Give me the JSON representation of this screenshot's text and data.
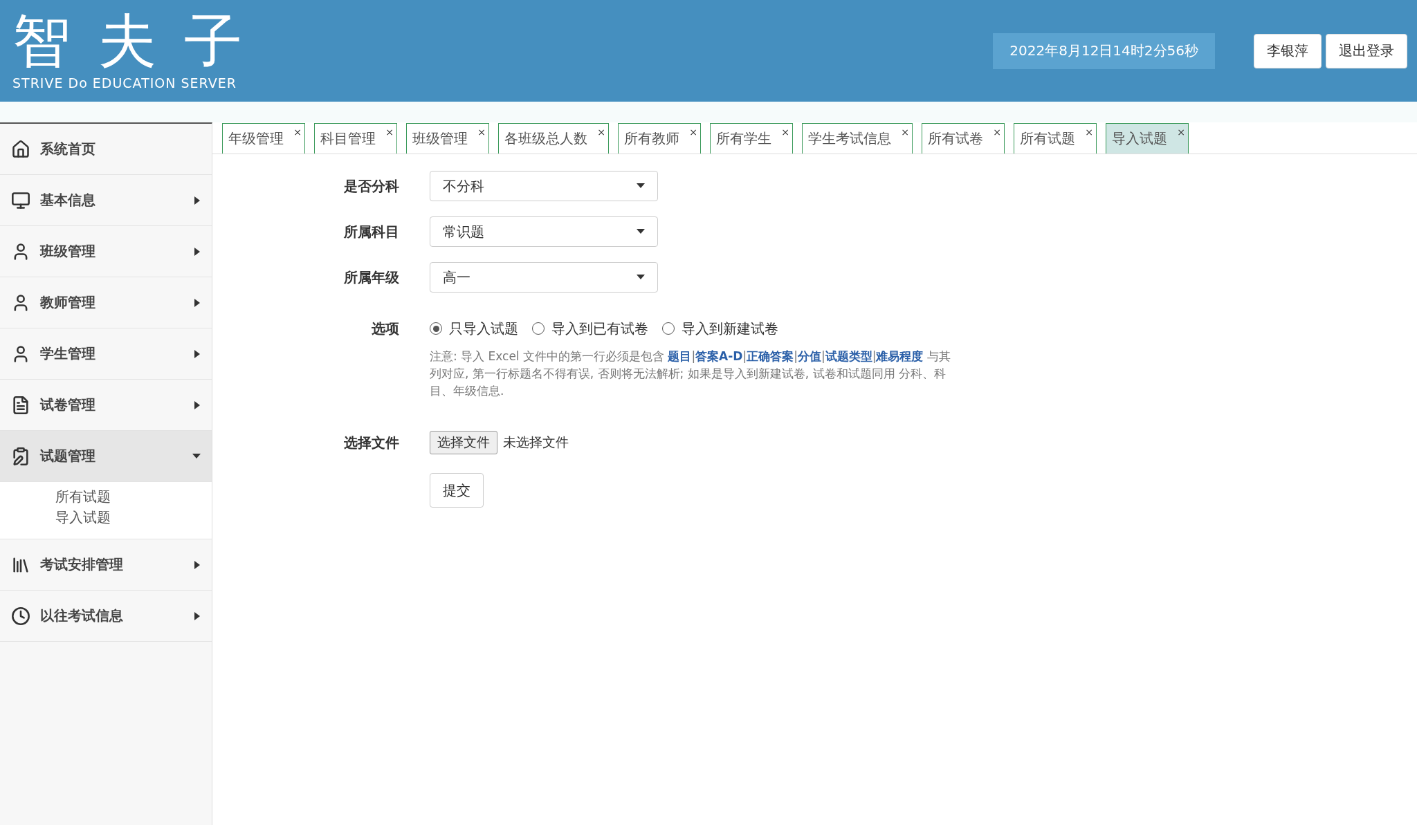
{
  "header": {
    "logo_title": "智夫子",
    "logo_subtitle": "STRIVE Do EDUCATION SERVER",
    "datetime": "2022年8月12日14时2分56秒",
    "user_button": "李银萍",
    "logout_button": "退出登录"
  },
  "sidebar": {
    "items": [
      {
        "label": "系统首页",
        "kind": "home",
        "expandable": false,
        "expanded": false
      },
      {
        "label": "基本信息",
        "kind": "monitor",
        "expandable": true,
        "expanded": false
      },
      {
        "label": "班级管理",
        "kind": "user",
        "expandable": true,
        "expanded": false
      },
      {
        "label": "教师管理",
        "kind": "user",
        "expandable": true,
        "expanded": false
      },
      {
        "label": "学生管理",
        "kind": "person",
        "expandable": true,
        "expanded": false
      },
      {
        "label": "试卷管理",
        "kind": "document",
        "expandable": true,
        "expanded": false
      },
      {
        "label": "试题管理",
        "kind": "clipboard",
        "expandable": true,
        "expanded": true,
        "children": [
          {
            "label": "所有试题"
          },
          {
            "label": "导入试题"
          }
        ]
      },
      {
        "label": "考试安排管理",
        "kind": "books",
        "expandable": true,
        "expanded": false
      },
      {
        "label": "以往考试信息",
        "kind": "clock",
        "expandable": true,
        "expanded": false
      }
    ]
  },
  "tabs": [
    {
      "label": "年级管理",
      "close": "×",
      "selected": false
    },
    {
      "label": "科目管理",
      "close": "×",
      "selected": false
    },
    {
      "label": "班级管理",
      "close": "×",
      "selected": false
    },
    {
      "label": "各班级总人数",
      "close": "×",
      "selected": false
    },
    {
      "label": "所有教师",
      "close": "×",
      "selected": false
    },
    {
      "label": "所有学生",
      "close": "×",
      "selected": false
    },
    {
      "label": "学生考试信息",
      "close": "×",
      "selected": false
    },
    {
      "label": "所有试卷",
      "close": "×",
      "selected": false
    },
    {
      "label": "所有试题",
      "close": "×",
      "selected": false
    },
    {
      "label": "导入试题",
      "close": "×",
      "selected": true
    }
  ],
  "form": {
    "selects": [
      {
        "label": "是否分科",
        "value": "不分科"
      },
      {
        "label": "所属科目",
        "value": "常识题"
      },
      {
        "label": "所属年级",
        "value": "高一"
      }
    ],
    "options": {
      "label": "选项",
      "choices": [
        {
          "label": "只导入试题",
          "selected": true
        },
        {
          "label": "导入到已有试卷",
          "selected": false
        },
        {
          "label": "导入到新建试卷",
          "selected": false
        }
      ],
      "note": "注意: 导入 Excel 文件中的第一行必须是包含 **题目**|**答案A-D**|**正确答案**|**分值**|**试题类型**|**难易程度** 与其列对应, 第一行标题名不得有误, 否则将无法解析; 如果是导入到新建试卷, 试卷和试题同用 分科、科目、年级信息."
    },
    "file": {
      "label": "选择文件",
      "button": "选择文件",
      "status": "未选择文件"
    },
    "submit": "提交"
  }
}
